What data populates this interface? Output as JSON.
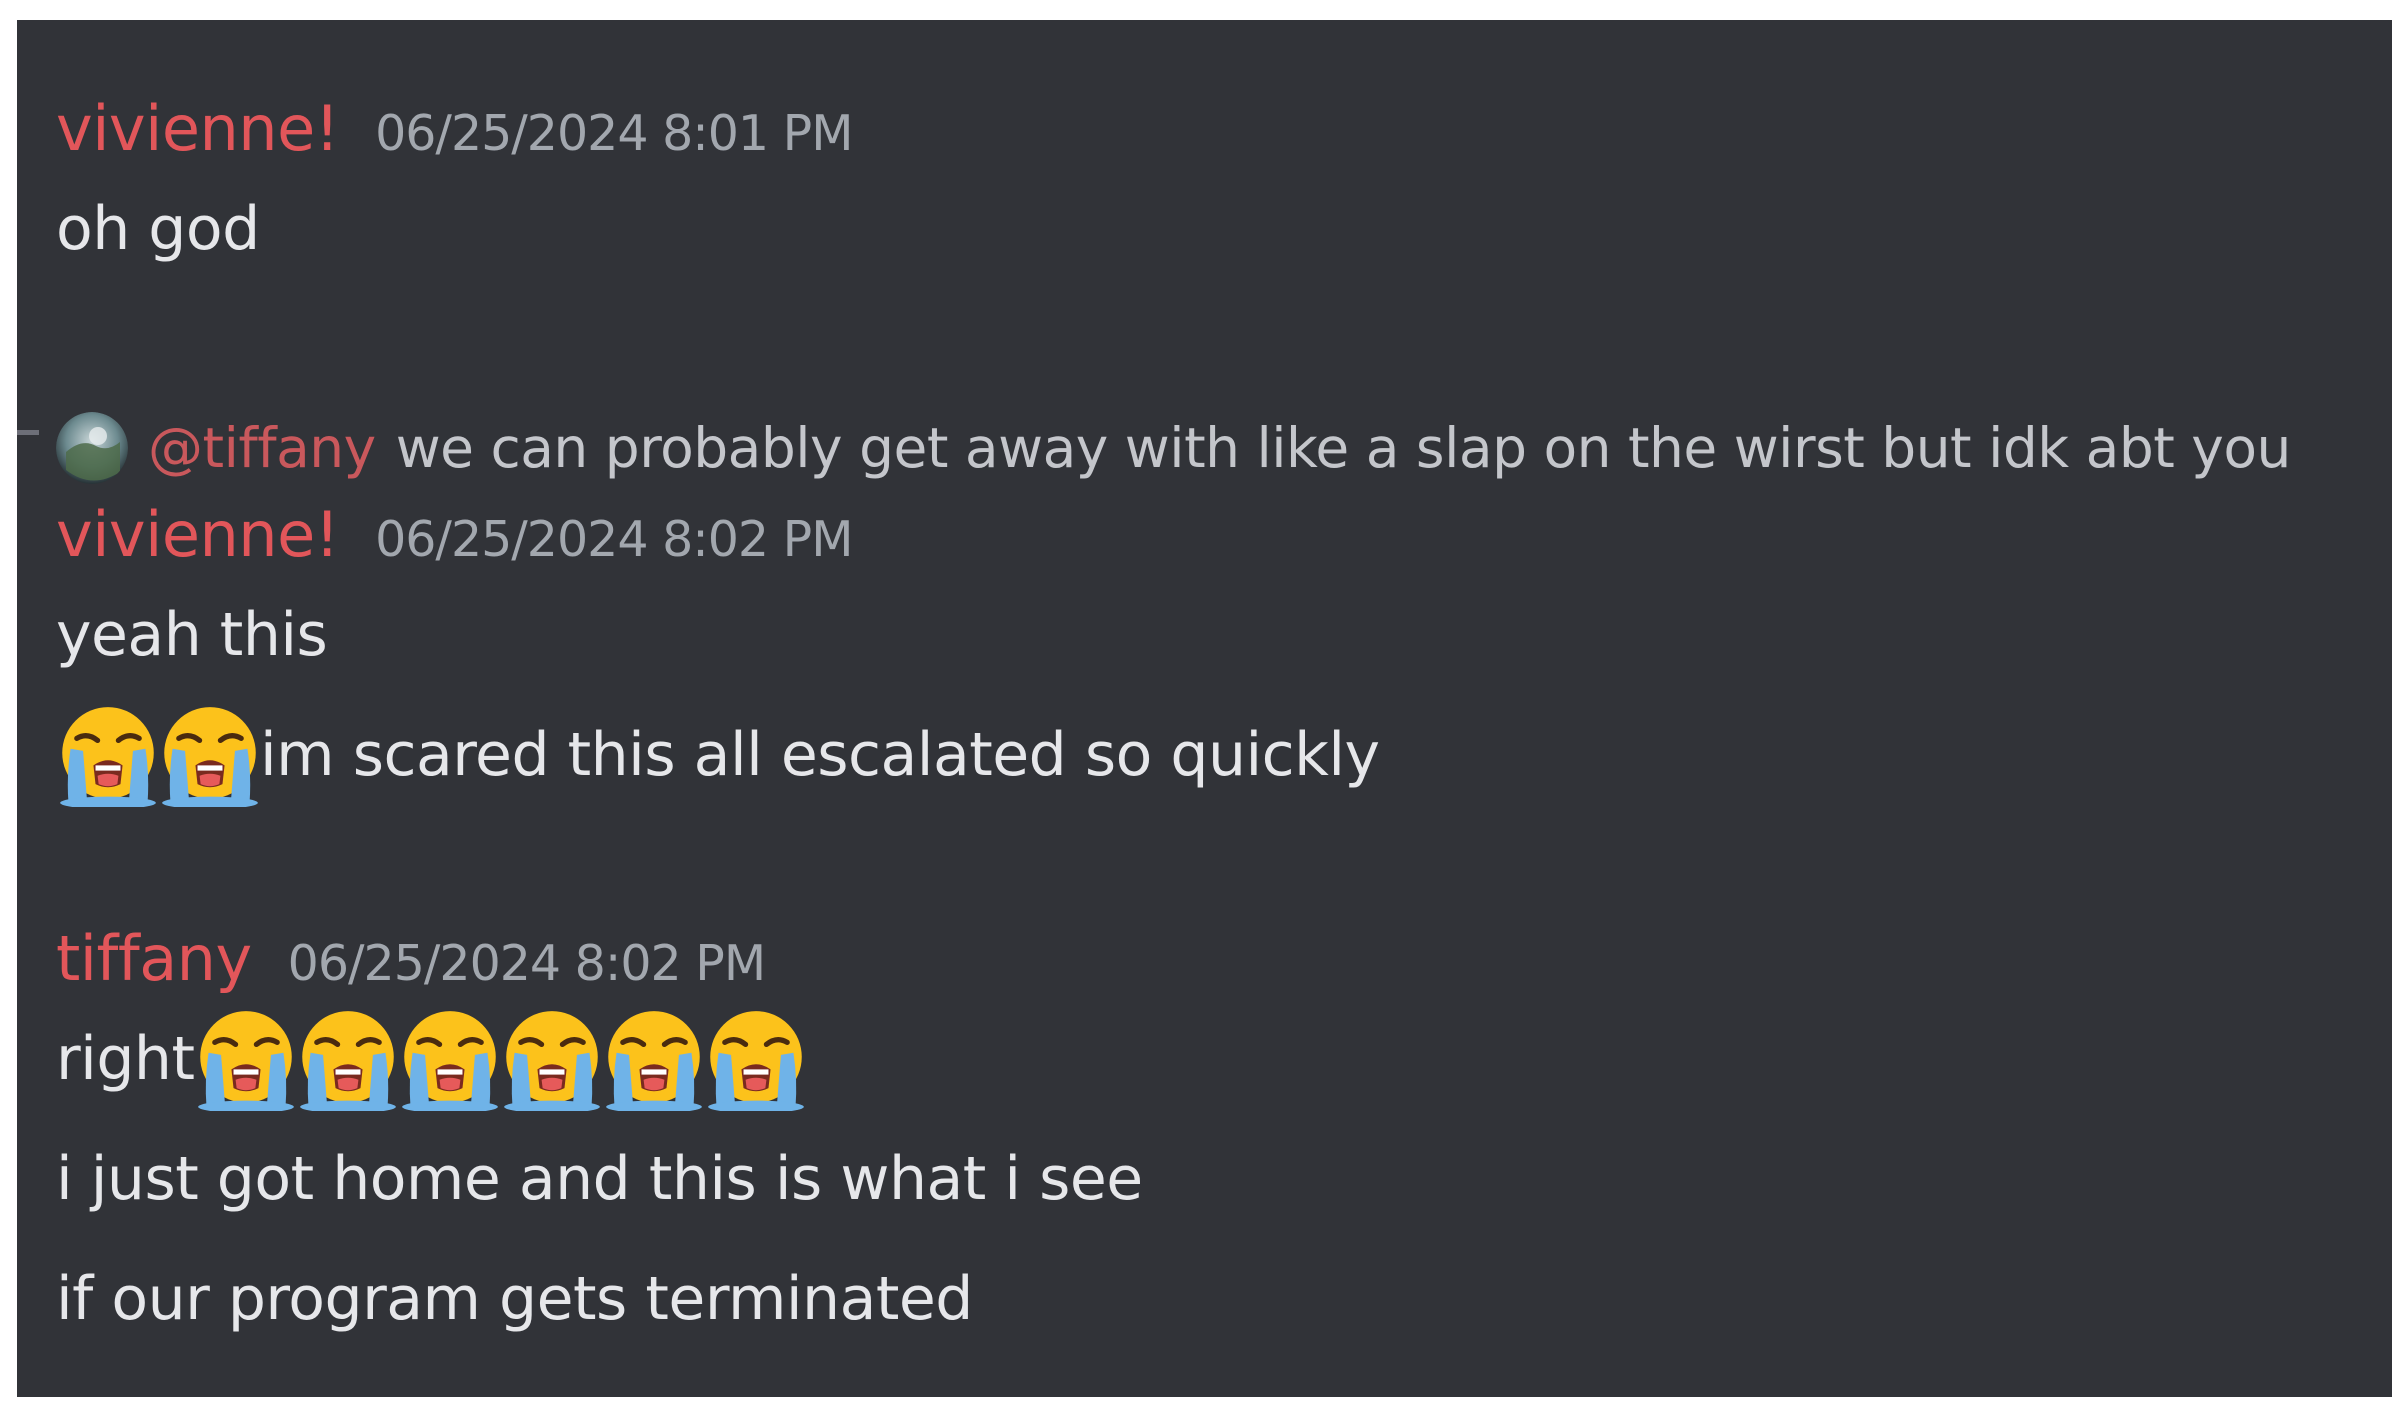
{
  "messages": [
    {
      "author": "vivienne!",
      "timestamp": "06/25/2024 8:01 PM",
      "lines": [
        "oh god"
      ]
    },
    {
      "reply": {
        "mention": "@tiffany",
        "text": "we can probably get away with like a slap on the wirst but idk abt you"
      },
      "author": "vivienne!",
      "timestamp": "06/25/2024 8:02 PM",
      "lines": [
        "yeah this",
        "im scared this all escalated so quickly"
      ]
    },
    {
      "author": "tiffany",
      "timestamp": "06/25/2024 8:02 PM",
      "lines": [
        "right",
        "i just got home and this is what i see",
        "if our program gets terminated"
      ]
    }
  ],
  "emoji": {
    "name": "loudly-crying-face-icon",
    "counts": {
      "message2_line2": 2,
      "message3_line1": 6
    }
  },
  "colors": {
    "background": "#313338",
    "username": "#e2565a",
    "timestamp": "#a2a7ae",
    "text": "#e6e7ea",
    "mention": "#c9585c"
  }
}
